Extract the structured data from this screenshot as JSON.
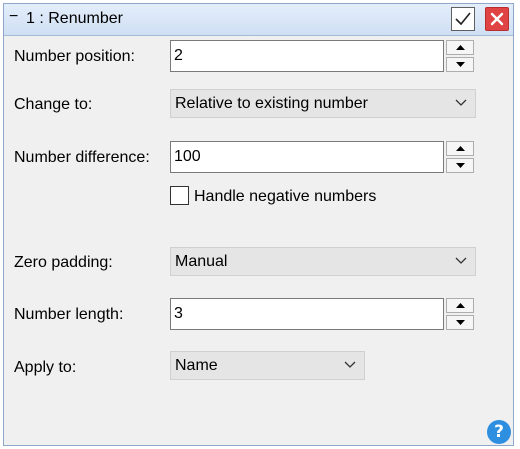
{
  "window": {
    "collapse_glyph": "−",
    "title": "1 : Renumber",
    "ok_icon": "checkmark-icon",
    "close_icon": "close-x-icon",
    "accent_close": "#e04343"
  },
  "form": {
    "number_position": {
      "label": "Number position:",
      "value": "2"
    },
    "change_to": {
      "label": "Change to:",
      "selected": "Relative to existing number"
    },
    "number_difference": {
      "label": "Number difference:",
      "value": "100"
    },
    "handle_negative": {
      "label": "Handle negative numbers",
      "checked": false
    },
    "zero_padding": {
      "label": "Zero padding:",
      "selected": "Manual"
    },
    "number_length": {
      "label": "Number length:",
      "value": "3"
    },
    "apply_to": {
      "label": "Apply to:",
      "selected": "Name"
    }
  },
  "help": {
    "glyph": "?",
    "icon": "help-icon",
    "color": "#2e8ee0"
  }
}
